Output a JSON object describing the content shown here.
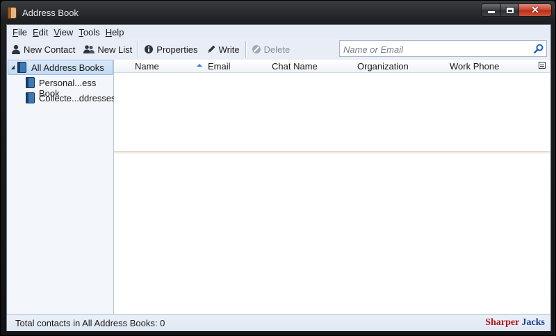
{
  "window": {
    "title": "Address Book"
  },
  "menu": [
    {
      "hotkey": "F",
      "rest": "ile"
    },
    {
      "hotkey": "E",
      "rest": "dit"
    },
    {
      "hotkey": "V",
      "rest": "iew"
    },
    {
      "hotkey": "T",
      "rest": "ools"
    },
    {
      "hotkey": "H",
      "rest": "elp"
    }
  ],
  "toolbar": {
    "new_contact": "New Contact",
    "new_list": "New List",
    "properties": "Properties",
    "write": "Write",
    "delete": "Delete"
  },
  "search": {
    "placeholder": "Name or Email"
  },
  "sidebar": {
    "root": "All Address Books",
    "books": [
      "Personal...ess Book",
      "Collecte...ddresses"
    ]
  },
  "columns": {
    "name": "Name",
    "email": "Email",
    "chat_name": "Chat Name",
    "organization": "Organization",
    "work_phone": "Work Phone"
  },
  "status": {
    "text": "Total contacts in All Address Books: 0"
  },
  "watermark": {
    "part1": "Sharper",
    "part2": "Jacks"
  },
  "icons": [
    "app-book-icon",
    "contact-icon",
    "group-icon",
    "info-icon",
    "pencil-icon",
    "delete-icon",
    "search-icon",
    "address-book-icon",
    "column-picker-icon"
  ]
}
